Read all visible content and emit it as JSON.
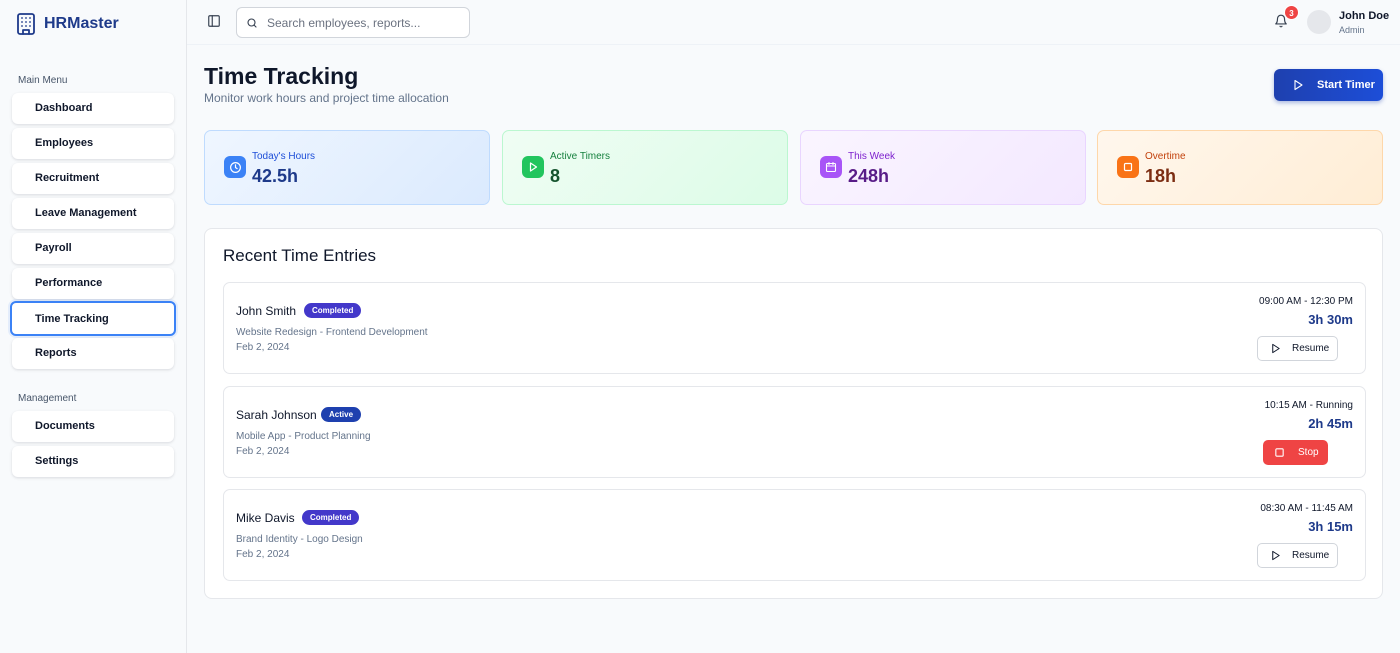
{
  "app": {
    "name": "HRMaster"
  },
  "sidebar": {
    "main_menu_label": "Main Menu",
    "main_items": [
      {
        "label": "Dashboard"
      },
      {
        "label": "Employees"
      },
      {
        "label": "Recruitment"
      },
      {
        "label": "Leave Management"
      },
      {
        "label": "Payroll"
      },
      {
        "label": "Performance"
      },
      {
        "label": "Time Tracking",
        "active": true
      },
      {
        "label": "Reports"
      }
    ],
    "management_label": "Management",
    "management_items": [
      {
        "label": "Documents"
      },
      {
        "label": "Settings"
      }
    ]
  },
  "header": {
    "search_placeholder": "Search employees, reports...",
    "notification_count": "3",
    "user": {
      "name": "John Doe",
      "role": "Admin"
    }
  },
  "page": {
    "title": "Time Tracking",
    "subtitle": "Monitor work hours and project time allocation",
    "start_timer_label": "Start Timer"
  },
  "stats": [
    {
      "label": "Today's Hours",
      "value": "42.5h",
      "icon": "clock-icon",
      "accent": "#3b82f6"
    },
    {
      "label": "Active Timers",
      "value": "8",
      "icon": "play-icon",
      "accent": "#22c55e"
    },
    {
      "label": "This Week",
      "value": "248h",
      "icon": "calendar-icon",
      "accent": "#a855f7"
    },
    {
      "label": "Overtime",
      "value": "18h",
      "icon": "square-icon",
      "accent": "#f97316"
    }
  ],
  "entries_panel": {
    "title": "Recent Time Entries",
    "entries": [
      {
        "name": "John Smith",
        "status": "Completed",
        "project": "Website Redesign - Frontend Development",
        "date": "Feb 2, 2024",
        "time_range": "09:00 AM - 12:30 PM",
        "duration": "3h 30m",
        "action": "Resume"
      },
      {
        "name": "Sarah Johnson",
        "status": "Active",
        "project": "Mobile App - Product Planning",
        "date": "Feb 2, 2024",
        "time_range": "10:15 AM - Running",
        "duration": "2h 45m",
        "action": "Stop"
      },
      {
        "name": "Mike Davis",
        "status": "Completed",
        "project": "Brand Identity - Logo Design",
        "date": "Feb 2, 2024",
        "time_range": "08:30 AM - 11:45 AM",
        "duration": "3h 15m",
        "action": "Resume"
      }
    ]
  },
  "colors": {
    "brand": "#1e3a8a",
    "primary_button": "#1e40af",
    "completed_badge": "#4338ca",
    "active_badge": "#1e40af",
    "stop_button": "#ef4444",
    "notification_badge": "#ef4444"
  }
}
